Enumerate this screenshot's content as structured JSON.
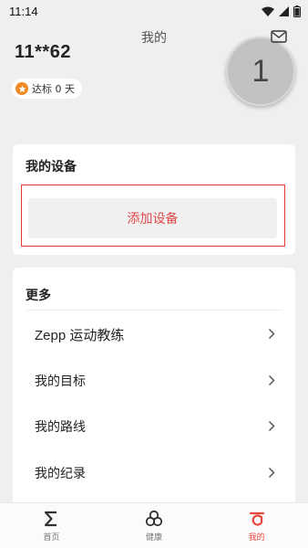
{
  "status_bar": {
    "time": "11:14",
    "icons": [
      "wifi-icon",
      "signal-icon",
      "battery-icon"
    ]
  },
  "header": {
    "title": "我的",
    "username": "11**62",
    "avatar_text": "1",
    "badge_label": "达标 0 天",
    "mail_icon": "mail-icon"
  },
  "device_card": {
    "title": "我的设备",
    "add_button": "添加设备"
  },
  "more_card": {
    "title": "更多",
    "items": [
      {
        "label": "Zepp 运动教练"
      },
      {
        "label": "我的目标"
      },
      {
        "label": "我的路线"
      },
      {
        "label": "我的纪录"
      }
    ]
  },
  "bottom_nav": {
    "items": [
      {
        "label": "首页",
        "icon": "sigma-icon",
        "active": false
      },
      {
        "label": "健康",
        "icon": "health-icon",
        "active": false
      },
      {
        "label": "我的",
        "icon": "profile-icon",
        "active": true
      }
    ]
  },
  "colors": {
    "accent": "#e8453c",
    "highlight_border": "#e23a3a",
    "badge": "#f08a24",
    "background": "#efefef"
  }
}
